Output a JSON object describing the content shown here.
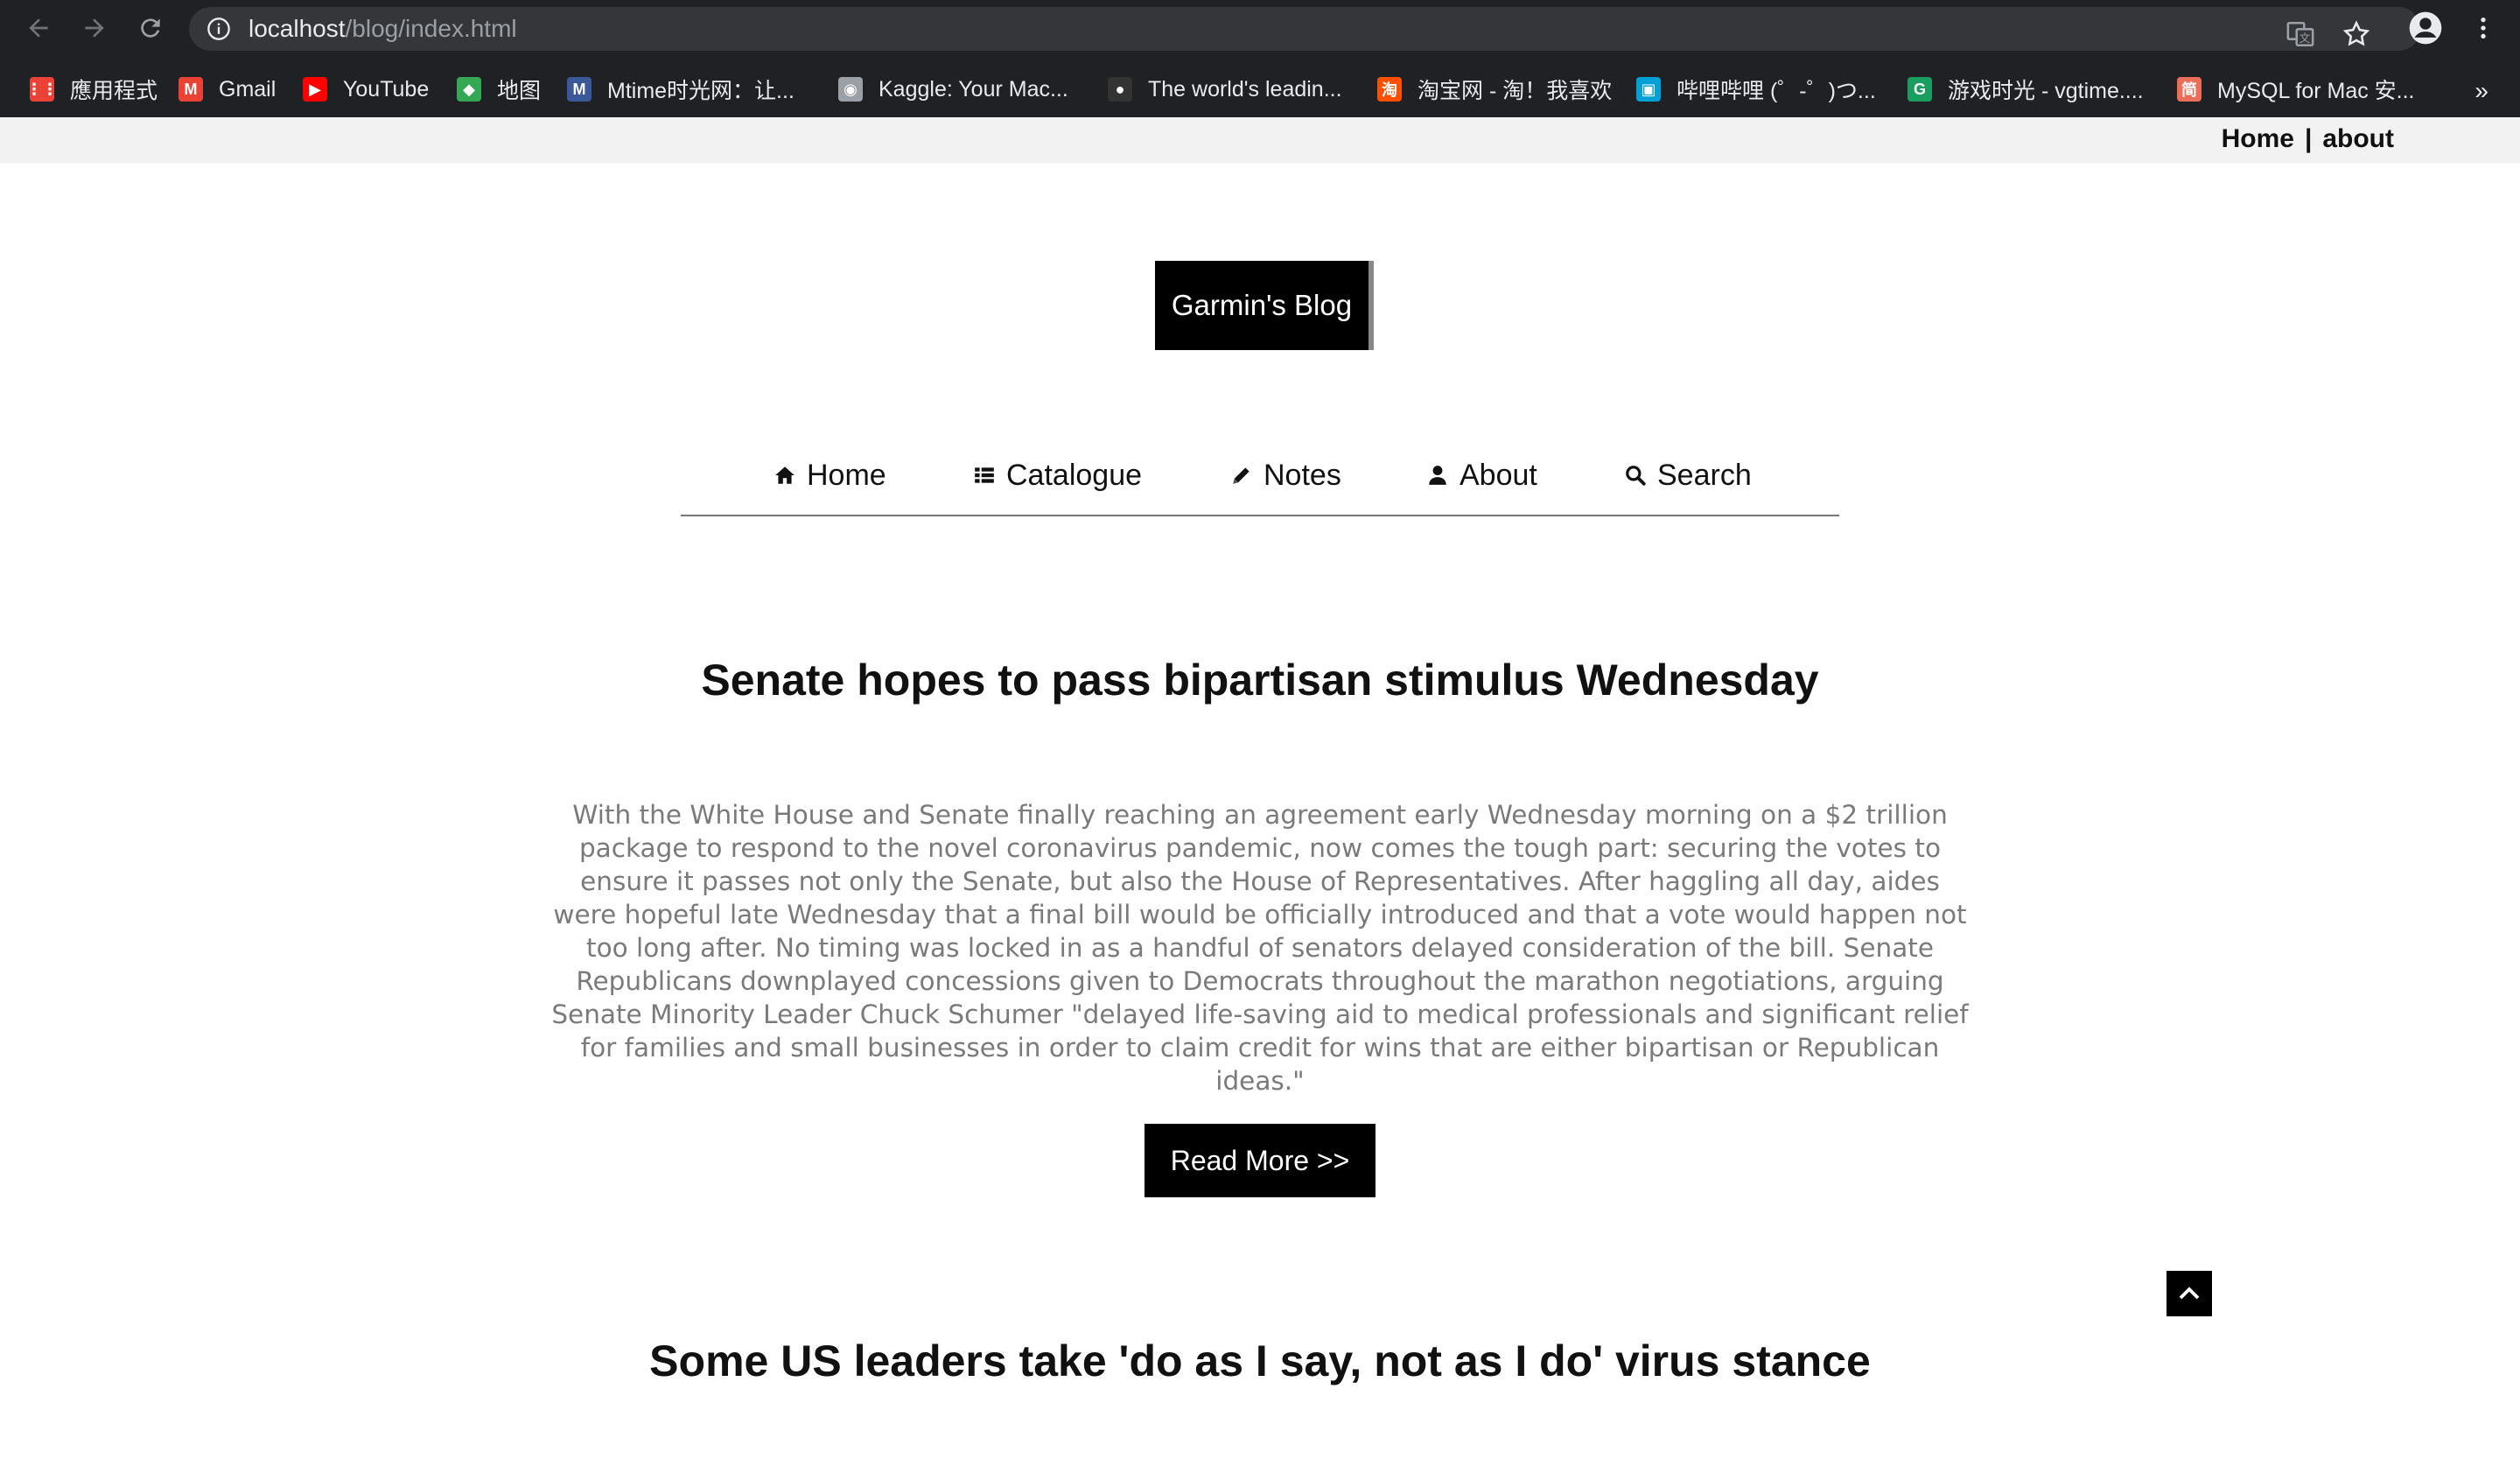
{
  "browser": {
    "url_host": "localhost",
    "url_path": "/blog/index.html",
    "bookmarks": [
      {
        "label": "應用程式",
        "icon": "apps-grid-icon",
        "color": "#ea4335"
      },
      {
        "label": "Gmail",
        "icon": "gmail-icon",
        "color": "#ea4335"
      },
      {
        "label": "YouTube",
        "icon": "youtube-icon",
        "color": "#ff0000"
      },
      {
        "label": "地图",
        "icon": "maps-icon",
        "color": "#34a853"
      },
      {
        "label": "Mtime时光网：让...",
        "icon": "mtime-icon",
        "color": "#3b5998"
      },
      {
        "label": "Kaggle: Your Mac...",
        "icon": "globe-icon",
        "color": "#9aa0a6"
      },
      {
        "label": "The world's leadin...",
        "icon": "github-icon",
        "color": "#333333"
      },
      {
        "label": "淘宝网 - 淘！我喜欢",
        "icon": "taobao-icon",
        "color": "#ff5000"
      },
      {
        "label": "哔哩哔哩 (゜-゜)つ...",
        "icon": "bilibili-icon",
        "color": "#00a1d6"
      },
      {
        "label": "游戏时光 - vgtime....",
        "icon": "vgtime-icon",
        "color": "#1a9e5f"
      },
      {
        "label": "MySQL for Mac 安...",
        "icon": "jianshu-icon",
        "color": "#ea6f5a"
      }
    ],
    "more_label": "»"
  },
  "topbar": {
    "home_label": "Home",
    "separator": "|",
    "about_label": "about"
  },
  "site": {
    "logo_text": "Garmin's Blog"
  },
  "menu": [
    {
      "label": "Home",
      "icon": "home-icon"
    },
    {
      "label": "Catalogue",
      "icon": "list-icon"
    },
    {
      "label": "Notes",
      "icon": "pencil-icon"
    },
    {
      "label": "About",
      "icon": "user-icon"
    },
    {
      "label": "Search",
      "icon": "search-icon"
    }
  ],
  "posts": [
    {
      "title": "Senate hopes to pass bipartisan stimulus Wednesday",
      "excerpt": "With the White House and Senate finally reaching an agreement early Wednesday morning on a $2 trillion package to respond to the novel coronavirus pandemic, now comes the tough part: securing the votes to ensure it passes not only the Senate, but also the House of Representatives. After haggling all day, aides were hopeful late Wednesday that a final bill would be officially introduced and that a vote would happen not too long after. No timing was locked in as a handful of senators delayed consideration of the bill. Senate Republicans downplayed concessions given to Democrats throughout the marathon negotiations, arguing Senate Minority Leader Chuck Schumer \"delayed life-saving aid to medical professionals and significant relief for families and small businesses in order to claim credit for wins that are either bipartisan or Republican ideas.\"",
      "read_more_label": "Read More >>"
    },
    {
      "title": "Some US leaders take 'do as I say, not as I do' virus stance"
    }
  ]
}
